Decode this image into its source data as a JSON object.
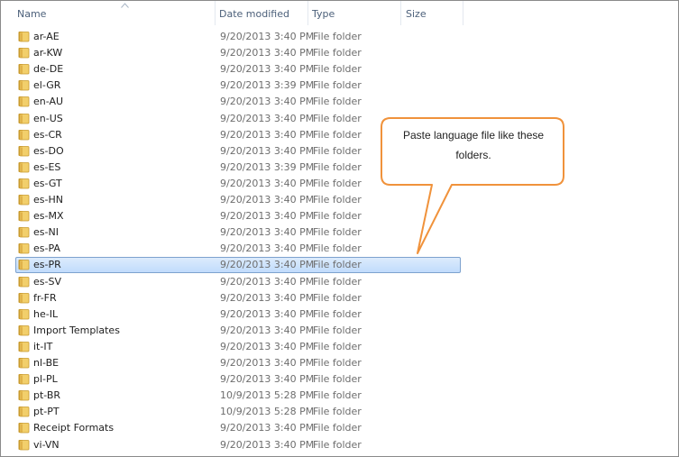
{
  "columns": {
    "name": "Name",
    "date_modified": "Date modified",
    "type": "Type",
    "size": "Size"
  },
  "sort": {
    "column": "name",
    "direction": "ascending",
    "icon": "sort-up-arrow"
  },
  "colors": {
    "selection_fill": "#cce3fc",
    "selection_border": "#7da2ce",
    "callout_border": "#f0923b",
    "folder": "#e8c05a"
  },
  "files": [
    {
      "name": "ar-AE",
      "date": "9/20/2013 3:40 PM",
      "type": "File folder",
      "selected": false
    },
    {
      "name": "ar-KW",
      "date": "9/20/2013 3:40 PM",
      "type": "File folder",
      "selected": false
    },
    {
      "name": "de-DE",
      "date": "9/20/2013 3:40 PM",
      "type": "File folder",
      "selected": false
    },
    {
      "name": "el-GR",
      "date": "9/20/2013 3:39 PM",
      "type": "File folder",
      "selected": false
    },
    {
      "name": "en-AU",
      "date": "9/20/2013 3:40 PM",
      "type": "File folder",
      "selected": false
    },
    {
      "name": "en-US",
      "date": "9/20/2013 3:40 PM",
      "type": "File folder",
      "selected": false
    },
    {
      "name": "es-CR",
      "date": "9/20/2013 3:40 PM",
      "type": "File folder",
      "selected": false
    },
    {
      "name": "es-DO",
      "date": "9/20/2013 3:40 PM",
      "type": "File folder",
      "selected": false
    },
    {
      "name": "es-ES",
      "date": "9/20/2013 3:39 PM",
      "type": "File folder",
      "selected": false
    },
    {
      "name": "es-GT",
      "date": "9/20/2013 3:40 PM",
      "type": "File folder",
      "selected": false
    },
    {
      "name": "es-HN",
      "date": "9/20/2013 3:40 PM",
      "type": "File folder",
      "selected": false
    },
    {
      "name": "es-MX",
      "date": "9/20/2013 3:40 PM",
      "type": "File folder",
      "selected": false
    },
    {
      "name": "es-NI",
      "date": "9/20/2013 3:40 PM",
      "type": "File folder",
      "selected": false
    },
    {
      "name": "es-PA",
      "date": "9/20/2013 3:40 PM",
      "type": "File folder",
      "selected": false
    },
    {
      "name": "es-PR",
      "date": "9/20/2013 3:40 PM",
      "type": "File folder",
      "selected": true
    },
    {
      "name": "es-SV",
      "date": "9/20/2013 3:40 PM",
      "type": "File folder",
      "selected": false
    },
    {
      "name": "fr-FR",
      "date": "9/20/2013 3:40 PM",
      "type": "File folder",
      "selected": false
    },
    {
      "name": "he-IL",
      "date": "9/20/2013 3:40 PM",
      "type": "File folder",
      "selected": false
    },
    {
      "name": "Import Templates",
      "date": "9/20/2013 3:40 PM",
      "type": "File folder",
      "selected": false
    },
    {
      "name": "it-IT",
      "date": "9/20/2013 3:40 PM",
      "type": "File folder",
      "selected": false
    },
    {
      "name": "nl-BE",
      "date": "9/20/2013 3:40 PM",
      "type": "File folder",
      "selected": false
    },
    {
      "name": "pl-PL",
      "date": "9/20/2013 3:40 PM",
      "type": "File folder",
      "selected": false
    },
    {
      "name": "pt-BR",
      "date": "10/9/2013 5:28 PM",
      "type": "File folder",
      "selected": false
    },
    {
      "name": "pt-PT",
      "date": "10/9/2013 5:28 PM",
      "type": "File folder",
      "selected": false
    },
    {
      "name": "Receipt Formats",
      "date": "9/20/2013 3:40 PM",
      "type": "File folder",
      "selected": false
    },
    {
      "name": "vi-VN",
      "date": "9/20/2013 3:40 PM",
      "type": "File folder",
      "selected": false
    }
  ],
  "callout": {
    "text": "Paste language file  like these folders."
  }
}
